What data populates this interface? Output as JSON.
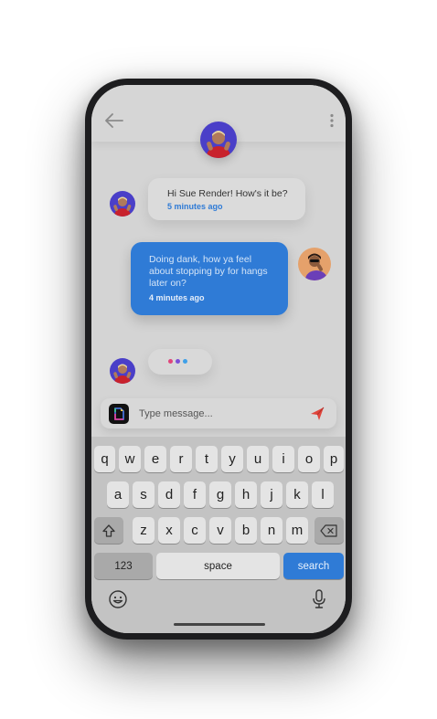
{
  "header": {
    "back_icon": "arrow-left-icon",
    "menu_icon": "vertical-dots-icon",
    "avatar": "contact-avatar"
  },
  "messages": [
    {
      "direction": "incoming",
      "text_lines": [
        "Hi Sue Render! How's it be?"
      ],
      "time": "5 minutes ago"
    },
    {
      "direction": "outgoing",
      "text_lines": [
        "Doing dank, how ya feel",
        "about stopping by for hangs",
        "later on?"
      ],
      "time": "4 minutes ago"
    }
  ],
  "typing_indicator": {
    "dot_colors": [
      "#e0457b",
      "#7b4fd6",
      "#3fa0e8"
    ]
  },
  "composer": {
    "placeholder": "Type message...",
    "send_icon": "send-icon",
    "app_icon": "app-icon"
  },
  "keyboard": {
    "row1": [
      "q",
      "w",
      "e",
      "r",
      "t",
      "y",
      "u",
      "i",
      "o",
      "p"
    ],
    "row2": [
      "a",
      "s",
      "d",
      "f",
      "g",
      "h",
      "j",
      "k",
      "l"
    ],
    "row3": [
      "z",
      "x",
      "c",
      "v",
      "b",
      "n",
      "m"
    ],
    "numbers_label": "123",
    "space_label": "space",
    "search_label": "search",
    "shift_icon": "shift-icon",
    "delete_icon": "backspace-icon",
    "emoji_icon": "emoji-icon",
    "mic_icon": "microphone-icon"
  },
  "colors": {
    "accent": "#2f7bd6",
    "screen_bg": "#d4d4d4",
    "keyboard_bg": "#c3c3c3"
  }
}
